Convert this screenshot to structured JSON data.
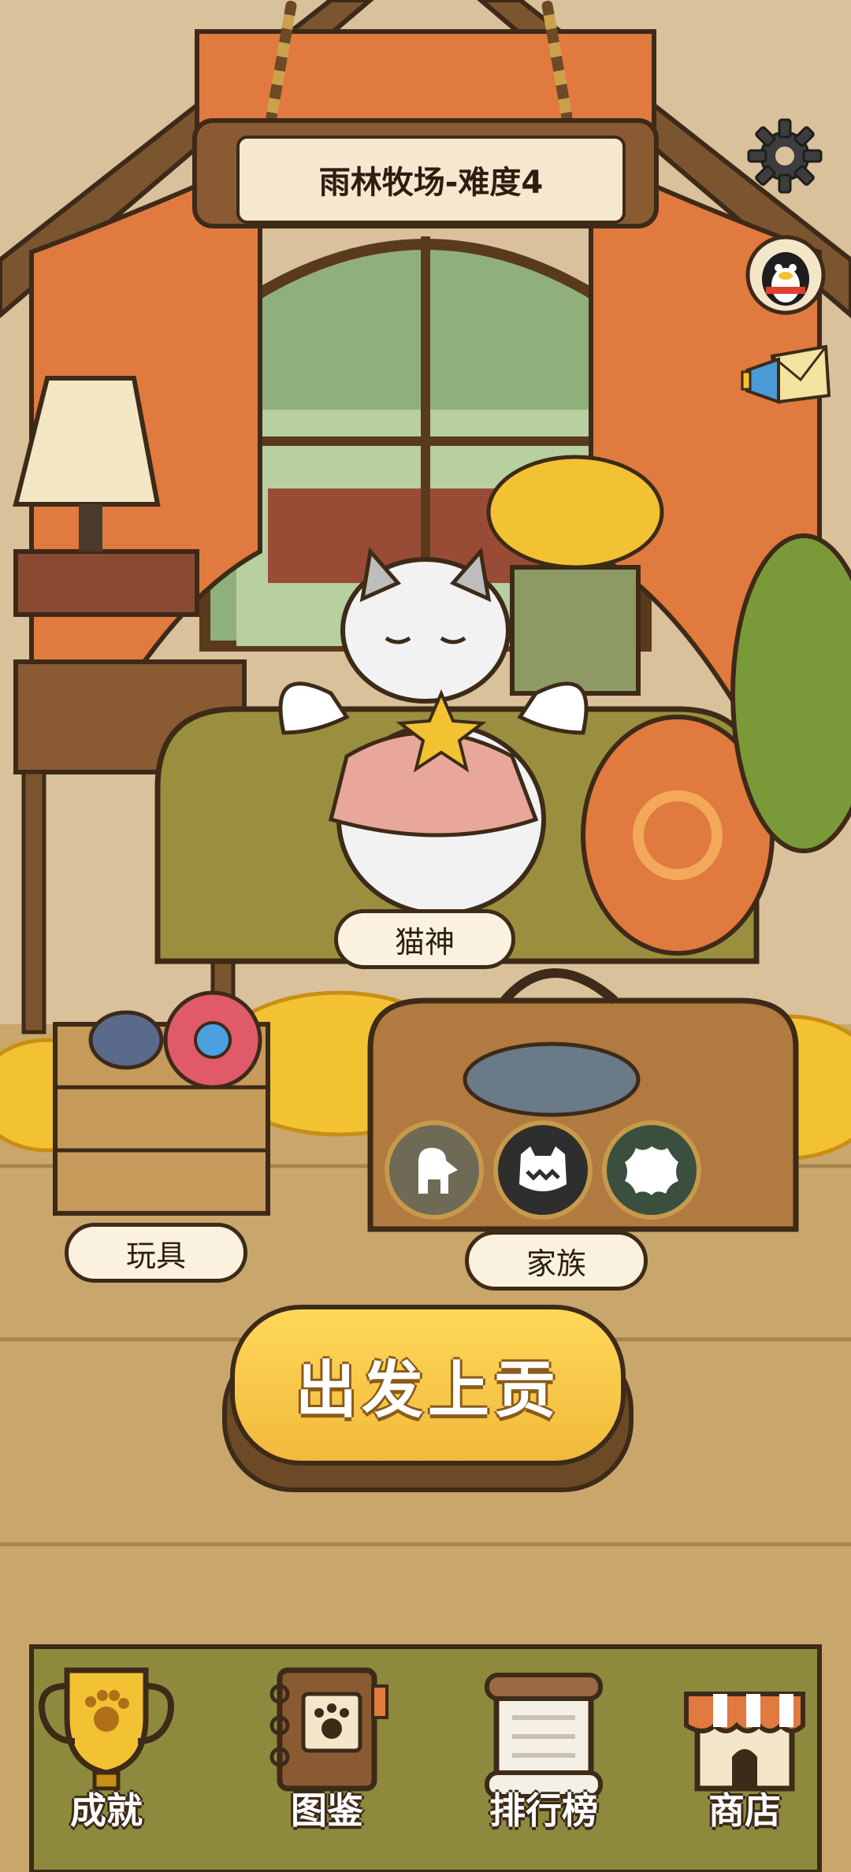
{
  "header": {
    "level_title": "雨林牧场-难度4"
  },
  "icons": {
    "settings": "gear-icon",
    "profile": "qq-penguin-avatar-icon",
    "announcement": "megaphone-letter-icon"
  },
  "pet": {
    "name": "猫神"
  },
  "labels": {
    "toys": "玩具",
    "family": "家族"
  },
  "family_buttons": [
    "dinosaur-icon",
    "monster-face-icon",
    "blob-icon"
  ],
  "action": {
    "start_label": "出发上贡"
  },
  "nav": [
    {
      "label": "成就",
      "icon": "trophy-icon"
    },
    {
      "label": "图鉴",
      "icon": "paw-notebook-icon"
    },
    {
      "label": "排行榜",
      "icon": "scroll-icon"
    },
    {
      "label": "商店",
      "icon": "shop-icon"
    }
  ],
  "colors": {
    "accent_yellow": "#f1b93b",
    "curtain": "#e07a3f",
    "wood_dark": "#3d2a18"
  }
}
